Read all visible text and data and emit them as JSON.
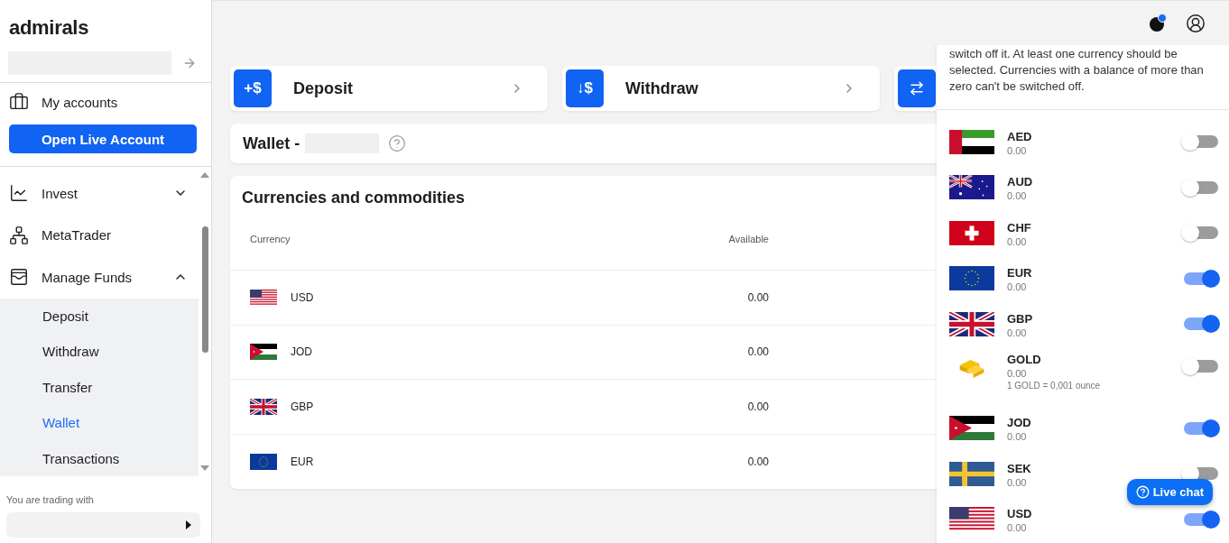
{
  "sidebar": {
    "logo": "admirals",
    "account_link": {
      "label": "My accounts"
    },
    "open_button": "Open Live Account",
    "nav": [
      {
        "label": "Invest",
        "expanded": false
      },
      {
        "label": "MetaTrader"
      },
      {
        "label": "Manage Funds",
        "expanded": true,
        "children": [
          {
            "label": "Deposit",
            "selected": false
          },
          {
            "label": "Withdraw",
            "selected": false
          },
          {
            "label": "Transfer",
            "selected": false
          },
          {
            "label": "Wallet",
            "selected": true
          },
          {
            "label": "Transactions",
            "selected": false
          }
        ]
      }
    ],
    "trading_label": "You are trading with"
  },
  "actions": [
    {
      "kind": "labelled",
      "label": "Deposit",
      "icon_text": "+$"
    },
    {
      "kind": "labelled",
      "label": "Withdraw",
      "icon_text": "↓$"
    },
    {
      "kind": "clipped"
    }
  ],
  "wallet": {
    "title": "Wallet -"
  },
  "table": {
    "title": "Currencies and commodities",
    "columns": [
      "Currency",
      "Available"
    ],
    "rows": [
      {
        "kind": "us",
        "currency": "USD",
        "available": "0.00"
      },
      {
        "kind": "jo",
        "currency": "JOD",
        "available": "0.00"
      },
      {
        "kind": "gb",
        "currency": "GBP",
        "available": "0.00"
      },
      {
        "kind": "eu",
        "currency": "EUR",
        "available": "0.00"
      }
    ]
  },
  "panel": {
    "description": "switch off it. At least one currency should be selected. Currencies with a balance of more than zero can't be switched off.",
    "items": [
      {
        "kind": "ae",
        "code": "AED",
        "balance": "0.00",
        "on": false
      },
      {
        "kind": "au",
        "code": "AUD",
        "balance": "0.00",
        "on": false
      },
      {
        "kind": "ch",
        "code": "CHF",
        "balance": "0.00",
        "on": false
      },
      {
        "kind": "eu",
        "code": "EUR",
        "balance": "0.00",
        "on": true
      },
      {
        "kind": "gb",
        "code": "GBP",
        "balance": "0.00",
        "on": true
      },
      {
        "kind": "gold",
        "code": "GOLD",
        "balance": "0.00",
        "note": "1 GOLD = 0,001 ounce",
        "on": false
      },
      {
        "kind": "jo",
        "code": "JOD",
        "balance": "0.00",
        "on": true
      },
      {
        "kind": "se",
        "code": "SEK",
        "balance": "0.00",
        "on": false
      },
      {
        "kind": "us",
        "code": "USD",
        "balance": "0.00",
        "on": true
      }
    ]
  },
  "live_chat": "Live chat"
}
